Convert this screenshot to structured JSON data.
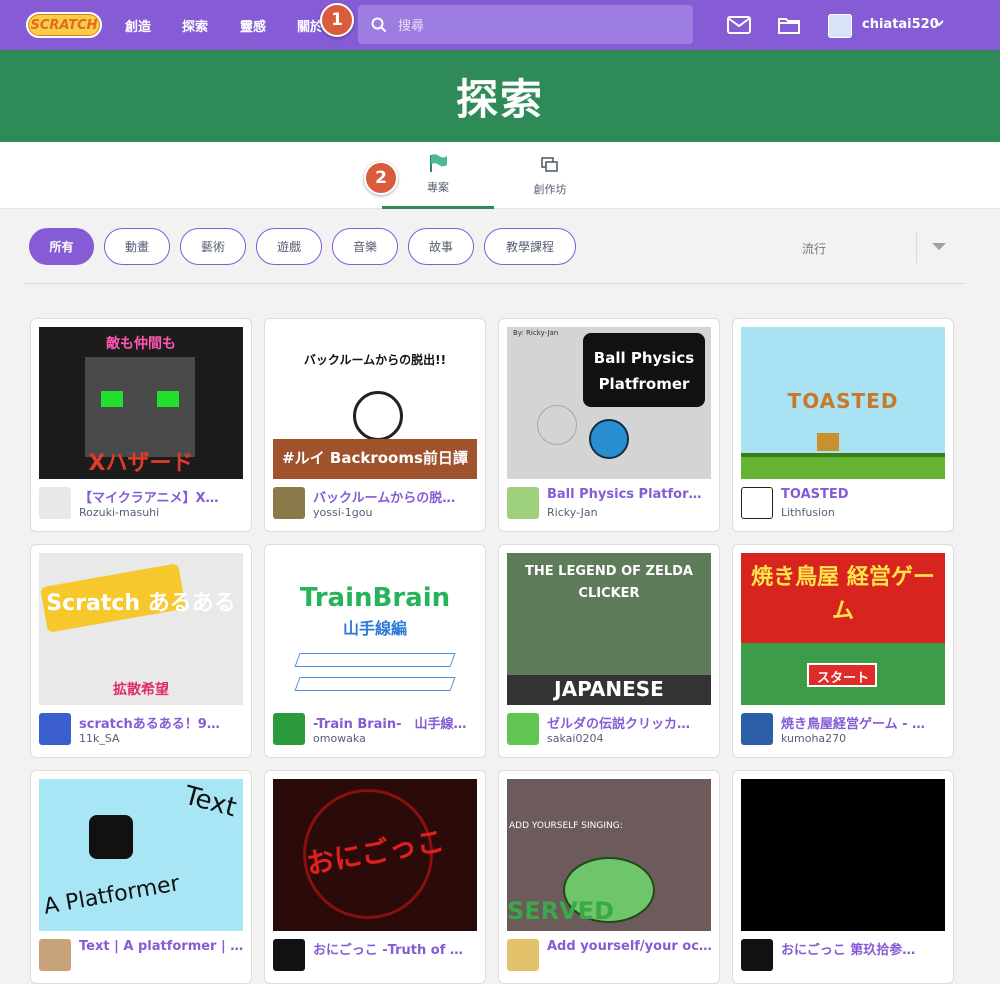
{
  "nav": {
    "logo": "SCRATCH",
    "links": [
      "創造",
      "探索",
      "靈感",
      "關於"
    ],
    "search_placeholder": "搜尋",
    "username": "chiatai520",
    "caret": "⌄"
  },
  "badges": [
    "1",
    "2"
  ],
  "banner": {
    "title": "探索"
  },
  "tabs": [
    {
      "label": "專案",
      "icon": "flag-icon",
      "active": true
    },
    {
      "label": "創作坊",
      "icon": "studio-icon",
      "active": false
    }
  ],
  "filters": [
    "所有",
    "動畫",
    "藝術",
    "遊戲",
    "音樂",
    "故事",
    "教學課程"
  ],
  "sort": {
    "label": "流行"
  },
  "colors": {
    "accent": "#855cd6",
    "banner": "#2e8b57",
    "badge": "#d95d3d"
  },
  "projects": [
    {
      "title": "【マイクラアニメ】X…",
      "author": "Rozuki-masuhi",
      "thumb_text": "Xハザード",
      "thumb_top": "敵も仲間も"
    },
    {
      "title": "バックルームからの脱…",
      "author": "yossi-1gou",
      "thumb_text": "#ルイ Backrooms前日譚",
      "thumb_top": "バックルームからの脱出!!"
    },
    {
      "title": "Ball Physics Platfor…",
      "author": "Ricky-Jan",
      "thumb_text": "Ball Physics Platfromer",
      "thumb_top": "By: Ricky-Jan"
    },
    {
      "title": "TOASTED",
      "author": "Lithfusion",
      "thumb_text": "TOASTED",
      "thumb_top": ""
    },
    {
      "title": "scratchあるある！9…",
      "author": "11k_SA",
      "thumb_text": "Scratch あるある",
      "thumb_top": "拡散希望"
    },
    {
      "title": "-Train Brain-　山手線…",
      "author": "omowaka",
      "thumb_text": "TrainBrain",
      "thumb_top": "山手線編"
    },
    {
      "title": "ゼルダの伝説クリッカ…",
      "author": "sakai0204",
      "thumb_text": "THE LEGEND OF ZELDA CLICKER",
      "thumb_top": "JAPANESE"
    },
    {
      "title": "焼き鳥屋経営ゲーム - …",
      "author": "kumoha270",
      "thumb_text": "焼き鳥屋 経営ゲーム",
      "thumb_top": "スタート"
    },
    {
      "title": "Text | A platformer | #…",
      "author": "",
      "thumb_text": "A Platformer",
      "thumb_top": "Text"
    },
    {
      "title": "おにごっこ -Truth of …",
      "author": "",
      "thumb_text": "おにごっこ",
      "thumb_top": ""
    },
    {
      "title": "Add yourself/your oc…",
      "author": "",
      "thumb_text": "SERVED",
      "thumb_top": "ADD YOURSELF SINGING:"
    },
    {
      "title": "おにごっこ 第玖拾参…",
      "author": "",
      "thumb_text": "",
      "thumb_top": ""
    }
  ]
}
